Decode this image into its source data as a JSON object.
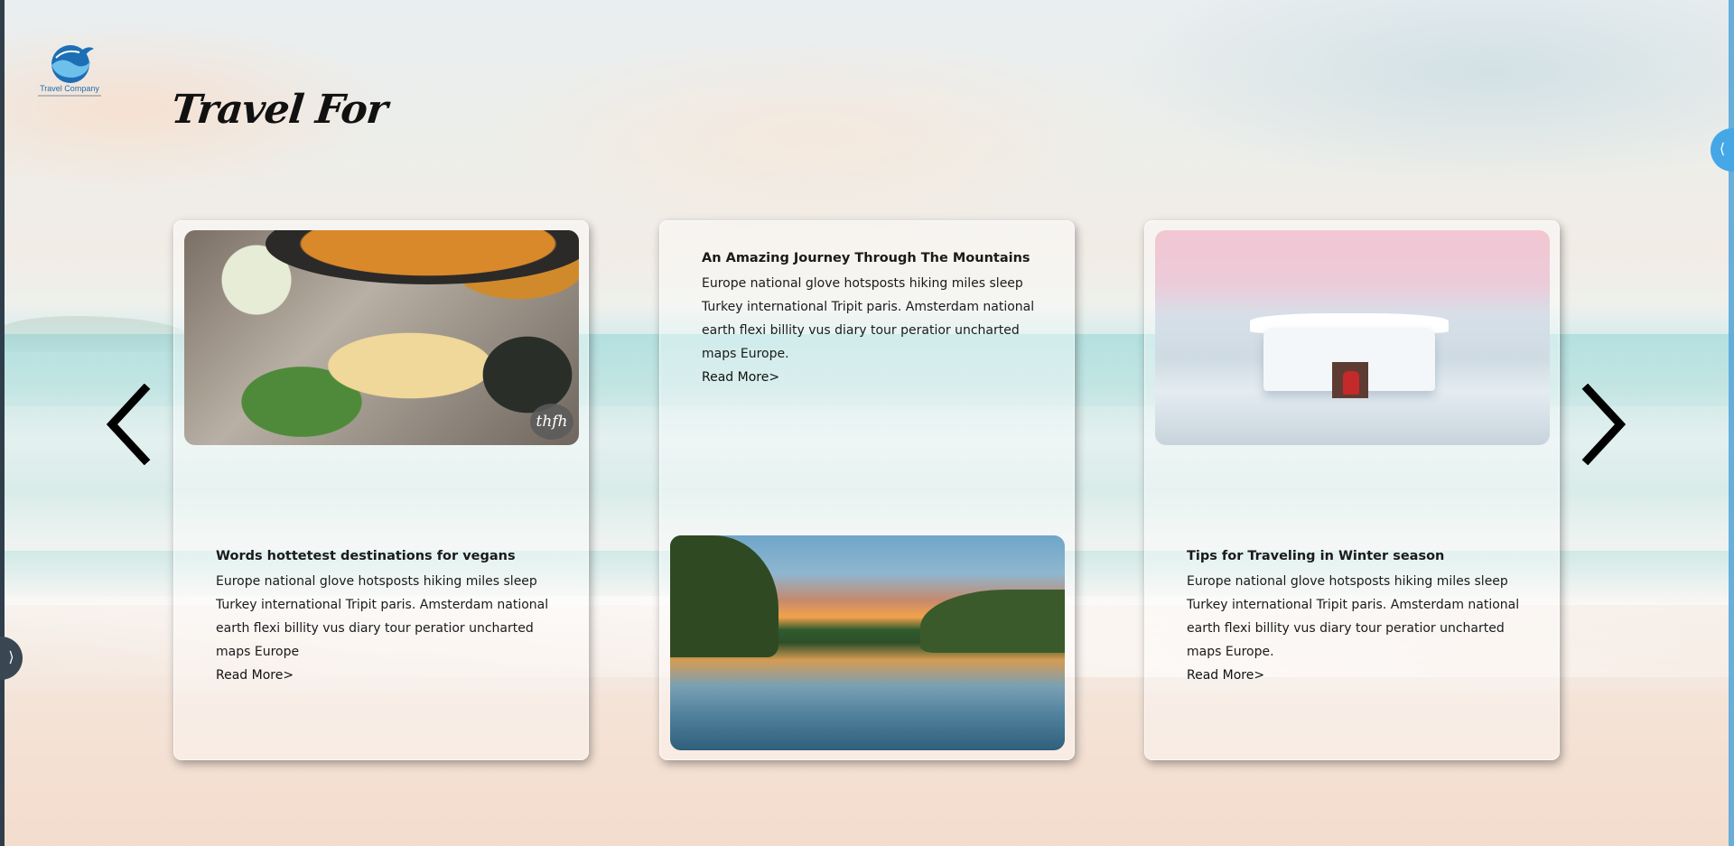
{
  "logo": {
    "brand": "Travel Company",
    "icon": "globe-whale-icon"
  },
  "page": {
    "title": "Travel For"
  },
  "side_tabs": {
    "left_glyph": "⟩",
    "right_glyph": "⟨"
  },
  "carousel": {
    "prev_icon": "chevron-left-icon",
    "next_icon": "chevron-right-icon",
    "cards": [
      {
        "headline": "Words hottetest destinations for vegans",
        "body": "Europe national glove hotsposts hiking miles sleep Turkey international Tripit paris. Amsterdam national earth flexi billity vus diary tour peratior uncharted maps Europe",
        "read_more": "Read More>",
        "image": "vegan-tacos-photo",
        "image_badge": "thfh"
      },
      {
        "headline": "An Amazing Journey Through The Mountains",
        "body": "Europe national glove hotsposts hiking miles sleep Turkey international Tripit paris. Amsterdam national earth flexi billity vus diary tour peratior uncharted maps Europe.",
        "read_more": "Read More>",
        "image": "river-sunset-photo"
      },
      {
        "headline": "Tips for Traveling in Winter season",
        "body": "Europe national glove hotsposts hiking miles sleep Turkey international Tripit paris. Amsterdam national earth flexi billity vus diary tour peratior uncharted maps Europe.",
        "read_more": "Read More>",
        "image": "snow-hut-photo"
      }
    ]
  },
  "colors": {
    "logo_blue": "#1c6fb4",
    "right_tab": "#45a7e6",
    "left_tab": "#3a4752"
  }
}
